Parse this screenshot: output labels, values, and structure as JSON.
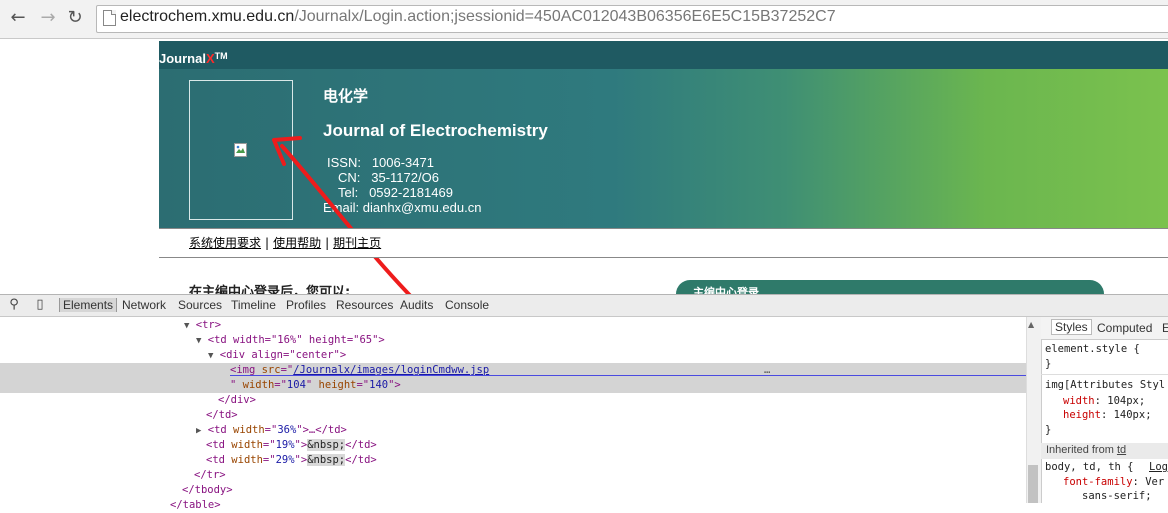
{
  "browser": {
    "url_host": "electrochem.xmu.edu.cn",
    "url_path": "/Journalx/Login.action;jsessionid=450AC012043B06356E6E5C15B37252C7"
  },
  "banner": {
    "logo_journal": "Journal",
    "logo_x": "X",
    "logo_tm": "TM",
    "title_cn": "电化学",
    "title_en": "Journal of Electrochemistry",
    "issn_label": "ISSN:",
    "issn": "1006-3471",
    "cn_label": "CN:",
    "cn": "35-1172/O6",
    "tel_label": "Tel:",
    "tel": "0592-2181469",
    "email_label": "Email:",
    "email": "dianhx@xmu.edu.cn"
  },
  "nav": {
    "link1": "系统使用要求",
    "link2": "使用帮助",
    "link3": "期刊主页"
  },
  "page": {
    "partial_heading": "在主编中心登录后，您可以:",
    "login_box_title": "主编中心登录"
  },
  "devtools": {
    "tabs": [
      "Elements",
      "Network",
      "Sources",
      "Timeline",
      "Profiles",
      "Resources",
      "Audits",
      "Console"
    ],
    "dom": {
      "tr_open": "<tr>",
      "td1": "<td width=\"16%\" height=\"65\">",
      "div_open": "<div align=\"center\">",
      "img_src": "/Journalx/images/loginCmdww.jsp",
      "img_dims_w": "104",
      "img_dims_h": "140",
      "div_close": "</div>",
      "td_close": "</td>",
      "td2_width": "36%",
      "td3_width": "19%",
      "td4_width": "29%",
      "nbsp": "&nbsp;",
      "tr_close": "</tr>",
      "tbody_close": "</tbody>",
      "table_close": "</table>",
      "ellipsis": "…"
    },
    "styles_tabs": [
      "Styles",
      "Computed",
      "E"
    ],
    "styles": {
      "element_style": "element.style {",
      "close_brace": "}",
      "img_attr_rule": "img[Attributes Styl",
      "width_prop": "width",
      "width_val": "104px;",
      "height_prop": "height",
      "height_val": "140px;",
      "inherited_label": "Inherited from",
      "inherited_from": "td",
      "body_selector": "body, td, th {",
      "body_link": "Log",
      "font_family_prop": "font-family",
      "font_family_val": "Ver",
      "font_family_val2": "sans-serif;"
    }
  }
}
